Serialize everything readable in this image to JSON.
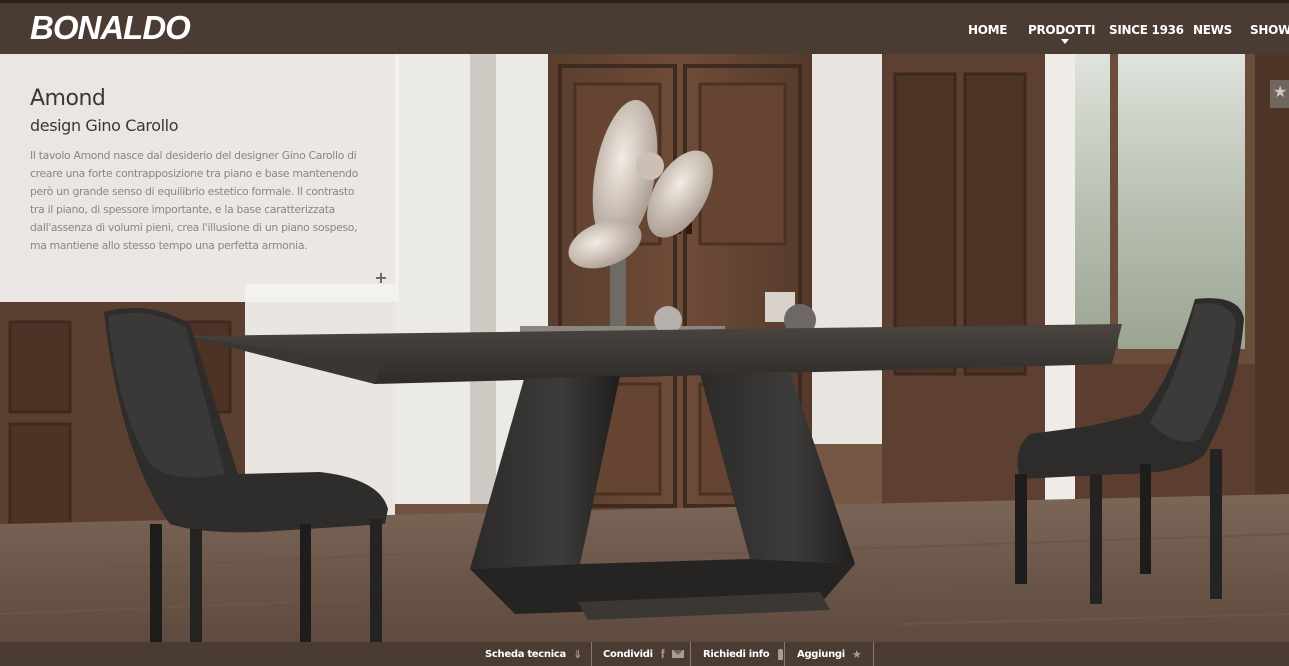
{
  "header": {
    "logo": "BONALDO",
    "nav": [
      {
        "label": "HOME"
      },
      {
        "label": "PRODOTTI",
        "has_dropdown": true
      },
      {
        "label": "SINCE 1936"
      },
      {
        "label": "NEWS"
      },
      {
        "label": "SHOWROOM"
      }
    ]
  },
  "product": {
    "title": "Amond",
    "designer": "design Gino Carollo",
    "description": "Il tavolo Amond nasce dal desiderio del designer Gino Carollo di creare una forte contrapposizione tra piano e base mantenendo però un grande senso di equilibrio estetico formale. Il contrasto tra il piano, di spessore importante, e la base caratterizzata dall'assenza di volumi pieni, crea l'illusione di un piano sospeso, ma mantiene allo stesso tempo una perfetta armonia.",
    "expand": "+"
  },
  "actions": {
    "scheda": {
      "label": "Scheda tecnica",
      "icon": "download-icon"
    },
    "condividi": {
      "label": "Condividi",
      "icons": [
        "facebook-icon",
        "mail-icon"
      ]
    },
    "richiedi": {
      "label": "Richiedi info",
      "icon": "info-icon"
    },
    "aggiungi": {
      "label": "Aggiungi",
      "icon": "star-icon"
    }
  },
  "colors": {
    "bar": "#4a3b33",
    "panel": "#f4f2f0"
  }
}
